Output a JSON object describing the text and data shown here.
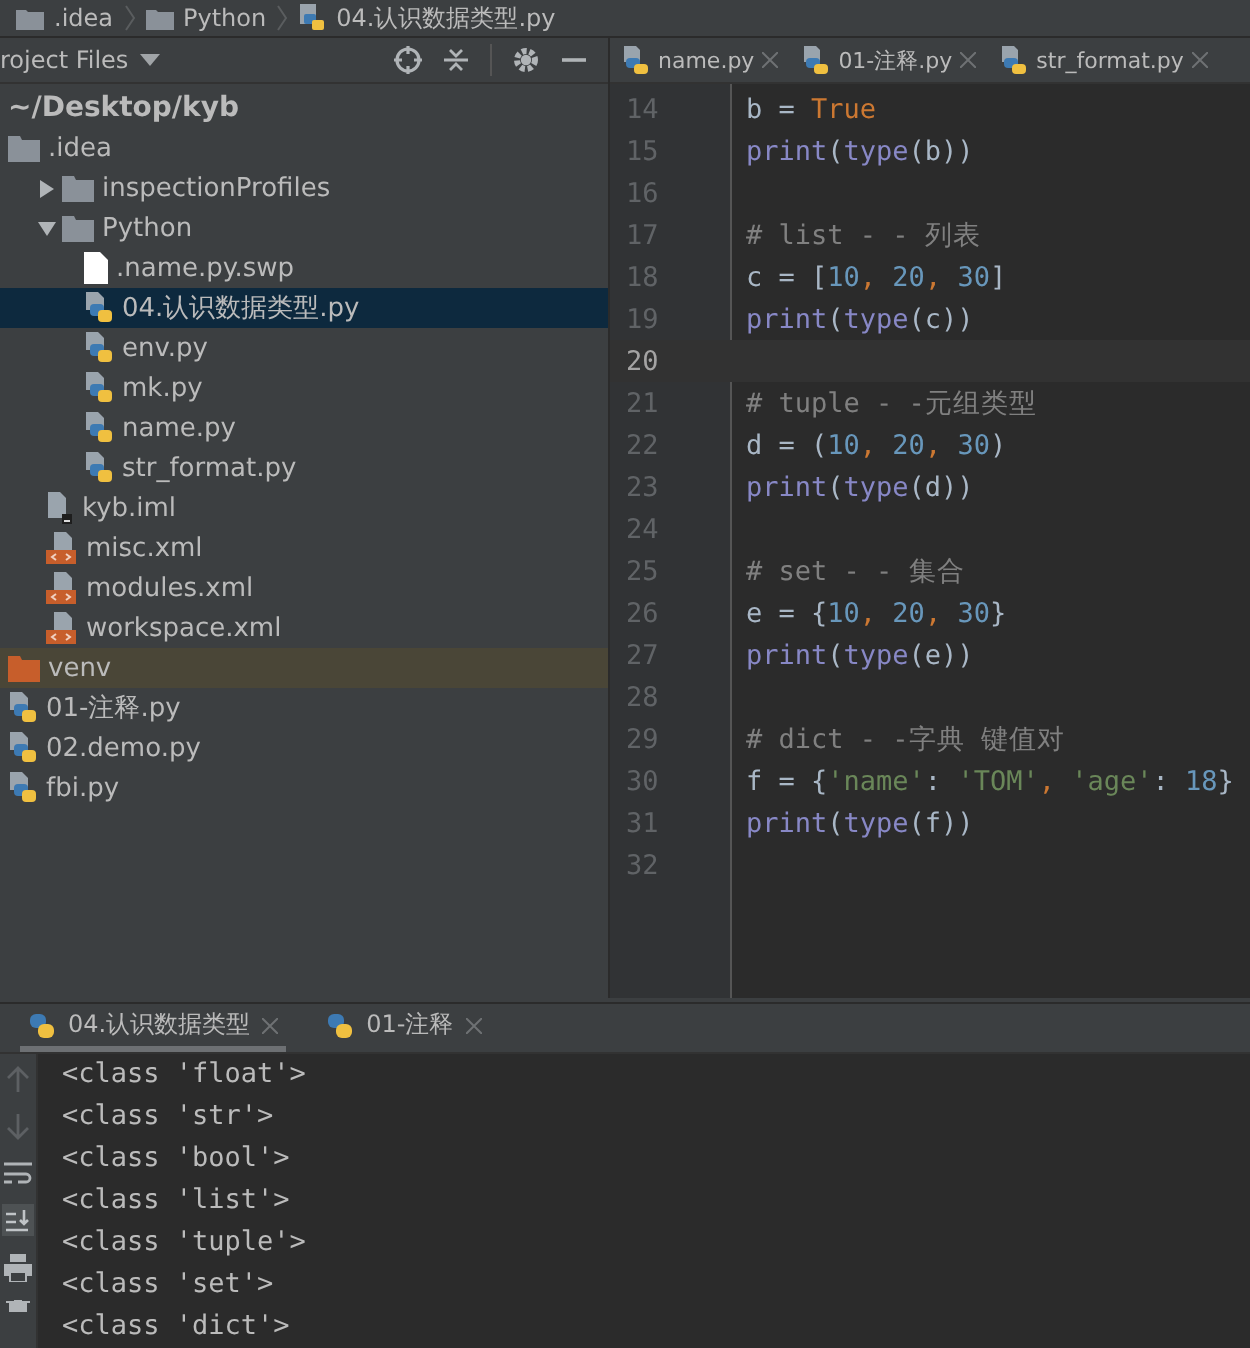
{
  "breadcrumb": [
    {
      "label": ".idea",
      "kind": "folder"
    },
    {
      "label": "Python",
      "kind": "folder"
    },
    {
      "label": "04.认识数据类型.py",
      "kind": "python"
    }
  ],
  "project": {
    "title": "roject Files",
    "tree": [
      {
        "label": "~/Desktop/kyb",
        "kind": "root",
        "selected": false,
        "children": [
          {
            "label": ".idea",
            "kind": "folder",
            "expanded": true,
            "selected": false,
            "children": [
              {
                "label": "inspectionProfiles",
                "kind": "folder",
                "expanded": false,
                "selected": false
              },
              {
                "label": "Python",
                "kind": "folder",
                "expanded": true,
                "selected": false,
                "children": [
                  {
                    "label": ".name.py.swp",
                    "kind": "text",
                    "selected": false
                  },
                  {
                    "label": "04.认识数据类型.py",
                    "kind": "python",
                    "selected": true
                  },
                  {
                    "label": "env.py",
                    "kind": "python",
                    "selected": false
                  },
                  {
                    "label": "mk.py",
                    "kind": "python",
                    "selected": false
                  },
                  {
                    "label": "name.py",
                    "kind": "python",
                    "selected": false
                  },
                  {
                    "label": "str_format.py",
                    "kind": "python",
                    "selected": false
                  }
                ]
              },
              {
                "label": "kyb.iml",
                "kind": "iml",
                "selected": false
              },
              {
                "label": "misc.xml",
                "kind": "xml",
                "selected": false
              },
              {
                "label": "modules.xml",
                "kind": "xml",
                "selected": false
              },
              {
                "label": "workspace.xml",
                "kind": "xml",
                "selected": false
              }
            ]
          },
          {
            "label": "venv",
            "kind": "excluded",
            "selected": false
          },
          {
            "label": "01-注释.py",
            "kind": "python",
            "selected": false
          },
          {
            "label": "02.demo.py",
            "kind": "python",
            "selected": false
          },
          {
            "label": "fbi.py",
            "kind": "python",
            "selected": false
          }
        ]
      }
    ]
  },
  "editor_tabs": [
    {
      "label": "name.py",
      "selected": false
    },
    {
      "label": "01-注释.py",
      "selected": false
    },
    {
      "label": "str_format.py",
      "selected": false
    }
  ],
  "code": [
    {
      "number": "14",
      "current": false,
      "tokens": [
        {
          "text": "b = ",
          "kind": "plain"
        },
        {
          "text": "True",
          "kind": "kw"
        }
      ]
    },
    {
      "number": "15",
      "current": false,
      "tokens": [
        {
          "text": "print",
          "kind": "builtin"
        },
        {
          "text": "(",
          "kind": "plain"
        },
        {
          "text": "type",
          "kind": "builtin"
        },
        {
          "text": "(b))",
          "kind": "plain"
        }
      ]
    },
    {
      "number": "16",
      "current": false
    },
    {
      "number": "17",
      "current": false,
      "tokens": [
        {
          "text": "# list - - 列表",
          "kind": "comment"
        }
      ]
    },
    {
      "number": "18",
      "current": false,
      "tokens": [
        {
          "text": "c = [",
          "kind": "plain"
        },
        {
          "text": "10",
          "kind": "num"
        },
        {
          "text": ", ",
          "kind": "kw"
        },
        {
          "text": "20",
          "kind": "num"
        },
        {
          "text": ", ",
          "kind": "kw"
        },
        {
          "text": "30",
          "kind": "num"
        },
        {
          "text": "]",
          "kind": "plain"
        }
      ]
    },
    {
      "number": "19",
      "current": false,
      "tokens": [
        {
          "text": "print",
          "kind": "builtin"
        },
        {
          "text": "(",
          "kind": "plain"
        },
        {
          "text": "type",
          "kind": "builtin"
        },
        {
          "text": "(c))",
          "kind": "plain"
        }
      ]
    },
    {
      "number": "20",
      "current": true
    },
    {
      "number": "21",
      "current": false,
      "tokens": [
        {
          "text": "# tuple - -元组类型",
          "kind": "comment"
        }
      ]
    },
    {
      "number": "22",
      "current": false,
      "tokens": [
        {
          "text": "d = (",
          "kind": "plain"
        },
        {
          "text": "10",
          "kind": "num"
        },
        {
          "text": ", ",
          "kind": "kw"
        },
        {
          "text": "20",
          "kind": "num"
        },
        {
          "text": ", ",
          "kind": "kw"
        },
        {
          "text": "30",
          "kind": "num"
        },
        {
          "text": ")",
          "kind": "plain"
        }
      ]
    },
    {
      "number": "23",
      "current": false,
      "tokens": [
        {
          "text": "print",
          "kind": "builtin"
        },
        {
          "text": "(",
          "kind": "plain"
        },
        {
          "text": "type",
          "kind": "builtin"
        },
        {
          "text": "(d))",
          "kind": "plain"
        }
      ]
    },
    {
      "number": "24",
      "current": false
    },
    {
      "number": "25",
      "current": false,
      "tokens": [
        {
          "text": "# set - -  集合",
          "kind": "comment"
        }
      ]
    },
    {
      "number": "26",
      "current": false,
      "tokens": [
        {
          "text": "e = {",
          "kind": "plain"
        },
        {
          "text": "10",
          "kind": "num"
        },
        {
          "text": ", ",
          "kind": "kw"
        },
        {
          "text": "20",
          "kind": "num"
        },
        {
          "text": ", ",
          "kind": "kw"
        },
        {
          "text": "30",
          "kind": "num"
        },
        {
          "text": "}",
          "kind": "plain"
        }
      ]
    },
    {
      "number": "27",
      "current": false,
      "tokens": [
        {
          "text": "print",
          "kind": "builtin"
        },
        {
          "text": "(",
          "kind": "plain"
        },
        {
          "text": "type",
          "kind": "builtin"
        },
        {
          "text": "(e))",
          "kind": "plain"
        }
      ]
    },
    {
      "number": "28",
      "current": false
    },
    {
      "number": "29",
      "current": false,
      "tokens": [
        {
          "text": "# dict - -字典   键值对",
          "kind": "comment"
        }
      ]
    },
    {
      "number": "30",
      "current": false,
      "tokens": [
        {
          "text": "f = {",
          "kind": "plain"
        },
        {
          "text": "'name'",
          "kind": "str"
        },
        {
          "text": ": ",
          "kind": "plain"
        },
        {
          "text": "'TOM'",
          "kind": "str"
        },
        {
          "text": ", ",
          "kind": "kw"
        },
        {
          "text": "'age'",
          "kind": "str"
        },
        {
          "text": ": ",
          "kind": "plain"
        },
        {
          "text": "18",
          "kind": "num"
        },
        {
          "text": "}",
          "kind": "plain"
        }
      ]
    },
    {
      "number": "31",
      "current": false,
      "tokens": [
        {
          "text": "print",
          "kind": "builtin"
        },
        {
          "text": "(",
          "kind": "plain"
        },
        {
          "text": "type",
          "kind": "builtin"
        },
        {
          "text": "(f))",
          "kind": "plain"
        }
      ]
    },
    {
      "number": "32",
      "current": false
    }
  ],
  "run_tabs": [
    {
      "label": "04.认识数据类型",
      "selected": true
    },
    {
      "label": "01-注释",
      "selected": false
    }
  ],
  "output": [
    "<class 'float'>",
    "<class 'str'>",
    "<class 'bool'>",
    "<class 'list'>",
    "<class 'tuple'>",
    "<class 'set'>",
    "<class 'dict'>"
  ]
}
